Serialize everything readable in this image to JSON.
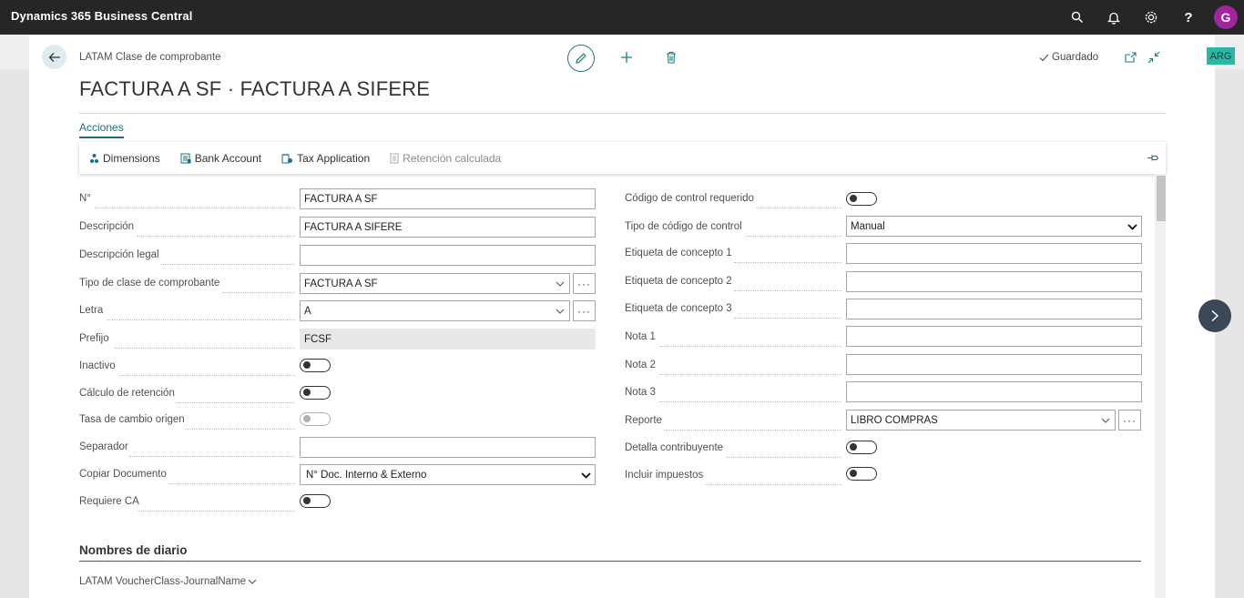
{
  "app": {
    "title": "Dynamics 365 Business Central",
    "user_initial": "G",
    "company_badge": "ARG"
  },
  "header": {
    "breadcrumb": "LATAM Clase de comprobante",
    "title": "FACTURA A SF · FACTURA A SIFERE",
    "saved_label": "Guardado"
  },
  "tabs": {
    "actions": "Acciones"
  },
  "actions": [
    {
      "label": "Dimensions",
      "icon": "dimensions-icon",
      "enabled": true
    },
    {
      "label": "Bank Account",
      "icon": "bank-account-icon",
      "enabled": true
    },
    {
      "label": "Tax Application",
      "icon": "tax-application-icon",
      "enabled": true
    },
    {
      "label": "Retención calculada",
      "icon": "document-icon",
      "enabled": false
    }
  ],
  "left_fields": [
    {
      "label": "N°",
      "type": "text",
      "value": "FACTURA A SF"
    },
    {
      "label": "Descripción",
      "type": "text",
      "value": "FACTURA A SIFERE"
    },
    {
      "label": "Descripción legal",
      "type": "text",
      "value": ""
    },
    {
      "label": "Tipo de clase de comprobante",
      "type": "lookup",
      "value": "FACTURA A SF"
    },
    {
      "label": "Letra",
      "type": "lookup",
      "value": "A"
    },
    {
      "label": "Prefijo",
      "type": "readonly",
      "value": "FCSF"
    },
    {
      "label": "Inactivo",
      "type": "toggle",
      "value": "off"
    },
    {
      "label": "Cálculo de retención",
      "type": "toggle",
      "value": "off"
    },
    {
      "label": "Tasa de cambio origen",
      "type": "toggle-disabled",
      "value": "off"
    },
    {
      "label": "Separador",
      "type": "text",
      "value": ""
    },
    {
      "label": "Copiar Documento",
      "type": "select",
      "value": "N° Doc. Interno & Externo"
    },
    {
      "label": "Requiere CA",
      "type": "toggle",
      "value": "off"
    }
  ],
  "right_fields": [
    {
      "label": "Código de control requerido",
      "type": "toggle",
      "value": "off"
    },
    {
      "label": "Tipo de código de control",
      "type": "select",
      "value": "Manual"
    },
    {
      "label": "Etiqueta de concepto 1",
      "type": "text",
      "value": ""
    },
    {
      "label": "Etiqueta de concepto 2",
      "type": "text",
      "value": ""
    },
    {
      "label": "Etiqueta de concepto 3",
      "type": "text",
      "value": ""
    },
    {
      "label": "Nota 1",
      "type": "text",
      "value": ""
    },
    {
      "label": "Nota 2",
      "type": "text",
      "value": ""
    },
    {
      "label": "Nota 3",
      "type": "text",
      "value": ""
    },
    {
      "label": "Reporte",
      "type": "lookup",
      "value": "LIBRO COMPRAS"
    },
    {
      "label": "Detalla contribuyente",
      "type": "toggle",
      "value": "off"
    },
    {
      "label": "Incluir impuestos",
      "type": "toggle",
      "value": "off"
    }
  ],
  "journal_section": {
    "title": "Nombres de diario",
    "subpart_label": "LATAM VoucherClass-JournalName"
  },
  "colors": {
    "accent": "#1c7a8a",
    "topbar": "#262626",
    "badge": "#2bb7a3",
    "avatar": "#a1259f"
  }
}
